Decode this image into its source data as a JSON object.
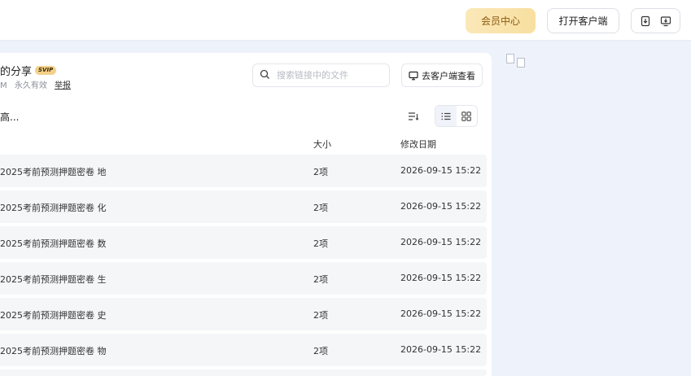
{
  "header": {
    "member_label": "会员中心",
    "open_client_label": "打开客户端"
  },
  "share": {
    "title": "的分享",
    "badge": "SVIP",
    "size_fragment": "M",
    "validity": "永久有效",
    "report": "举报"
  },
  "search": {
    "placeholder": "搜索链接中的文件"
  },
  "client_button": {
    "label": "去客户端查看"
  },
  "path": {
    "text": "高..."
  },
  "columns": {
    "size": "大小",
    "modified": "修改日期"
  },
  "files": [
    {
      "name": "2025考前预测押题密卷 地",
      "size": "2项",
      "date": "2026-09-15 15:22"
    },
    {
      "name": "2025考前预测押题密卷 化",
      "size": "2项",
      "date": "2026-09-15 15:22"
    },
    {
      "name": "2025考前预测押题密卷 数",
      "size": "2项",
      "date": "2026-09-15 15:22"
    },
    {
      "name": "2025考前预测押题密卷 生",
      "size": "2项",
      "date": "2026-09-15 15:22"
    },
    {
      "name": "2025考前预测押题密卷 史",
      "size": "2项",
      "date": "2026-09-15 15:22"
    },
    {
      "name": "2025考前预测押题密卷 物",
      "size": "2项",
      "date": "2026-09-15 15:22"
    }
  ],
  "icons": {
    "download": "download-icon",
    "client_download": "monitor-download-icon",
    "search": "search-icon",
    "monitor": "monitor-icon",
    "sort": "sort-icon",
    "list_view": "list-view-icon",
    "grid_view": "grid-view-icon",
    "broken_image": "broken-image-icon"
  },
  "colors": {
    "member_bg": "#f8dfa0",
    "member_text": "#8a5a12",
    "page_bg": "#eef2fb",
    "row_bg": "#f5f6f8"
  }
}
